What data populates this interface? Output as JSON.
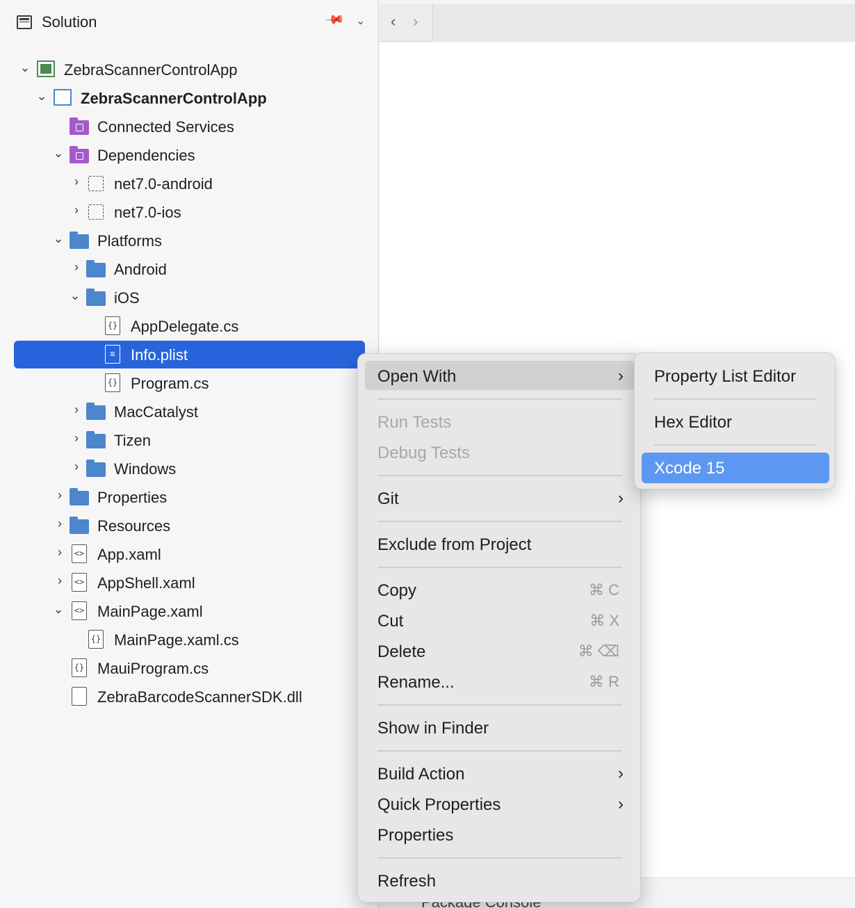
{
  "pane": {
    "title": "Solution"
  },
  "tree": [
    {
      "label": "ZebraScannerControlApp",
      "bold": false
    },
    {
      "label": "ZebraScannerControlApp",
      "bold": true
    },
    {
      "label": "Connected Services"
    },
    {
      "label": "Dependencies"
    },
    {
      "label": "net7.0-android"
    },
    {
      "label": "net7.0-ios"
    },
    {
      "label": "Platforms"
    },
    {
      "label": "Android"
    },
    {
      "label": "iOS"
    },
    {
      "label": "AppDelegate.cs"
    },
    {
      "label": "Info.plist"
    },
    {
      "label": "Program.cs"
    },
    {
      "label": "MacCatalyst"
    },
    {
      "label": "Tizen"
    },
    {
      "label": "Windows"
    },
    {
      "label": "Properties"
    },
    {
      "label": "Resources"
    },
    {
      "label": "App.xaml"
    },
    {
      "label": "AppShell.xaml"
    },
    {
      "label": "MainPage.xaml"
    },
    {
      "label": "MainPage.xaml.cs"
    },
    {
      "label": "MauiProgram.cs"
    },
    {
      "label": "ZebraBarcodeScannerSDK.dll"
    }
  ],
  "context_menu": {
    "open_with": "Open With",
    "run_tests": "Run Tests",
    "debug_tests": "Debug Tests",
    "git": "Git",
    "exclude": "Exclude from Project",
    "copy": "Copy",
    "copy_shortcut": "⌘ C",
    "cut": "Cut",
    "cut_shortcut": "⌘ X",
    "delete": "Delete",
    "delete_shortcut": "⌘ ⌫",
    "rename": "Rename...",
    "rename_shortcut": "⌘ R",
    "show_in_finder": "Show in Finder",
    "build_action": "Build Action",
    "quick_properties": "Quick Properties",
    "properties": "Properties",
    "refresh": "Refresh"
  },
  "submenu": {
    "property_list_editor": "Property List Editor",
    "hex_editor": "Hex Editor",
    "xcode": "Xcode 15"
  },
  "bottom_strip": {
    "peek_text": "Package Console"
  },
  "colors": {
    "selection": "#2864dc",
    "submenu_active": "#5c98f2",
    "folder": "#4a87cc",
    "purple_folder": "#a45bc9"
  }
}
